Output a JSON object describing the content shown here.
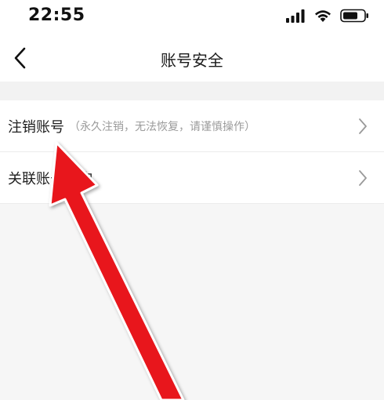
{
  "status_bar": {
    "time": "22:55",
    "icons": [
      "signal-icon",
      "wifi-icon",
      "battery-icon"
    ]
  },
  "nav": {
    "back_icon": "chevron-left-icon",
    "title": "账号安全"
  },
  "list": {
    "items": [
      {
        "label": "注销账号",
        "hint": "（永久注销，无法恢复，请谨慎操作）",
        "icon": "chevron-right-icon"
      },
      {
        "label": "关联账号查询",
        "hint": "",
        "icon": "chevron-right-icon"
      }
    ]
  },
  "colors": {
    "background": "#f6f6f6",
    "surface": "#ffffff",
    "hint_text": "#9b9b9b",
    "annotation_arrow": "#e8141c"
  }
}
